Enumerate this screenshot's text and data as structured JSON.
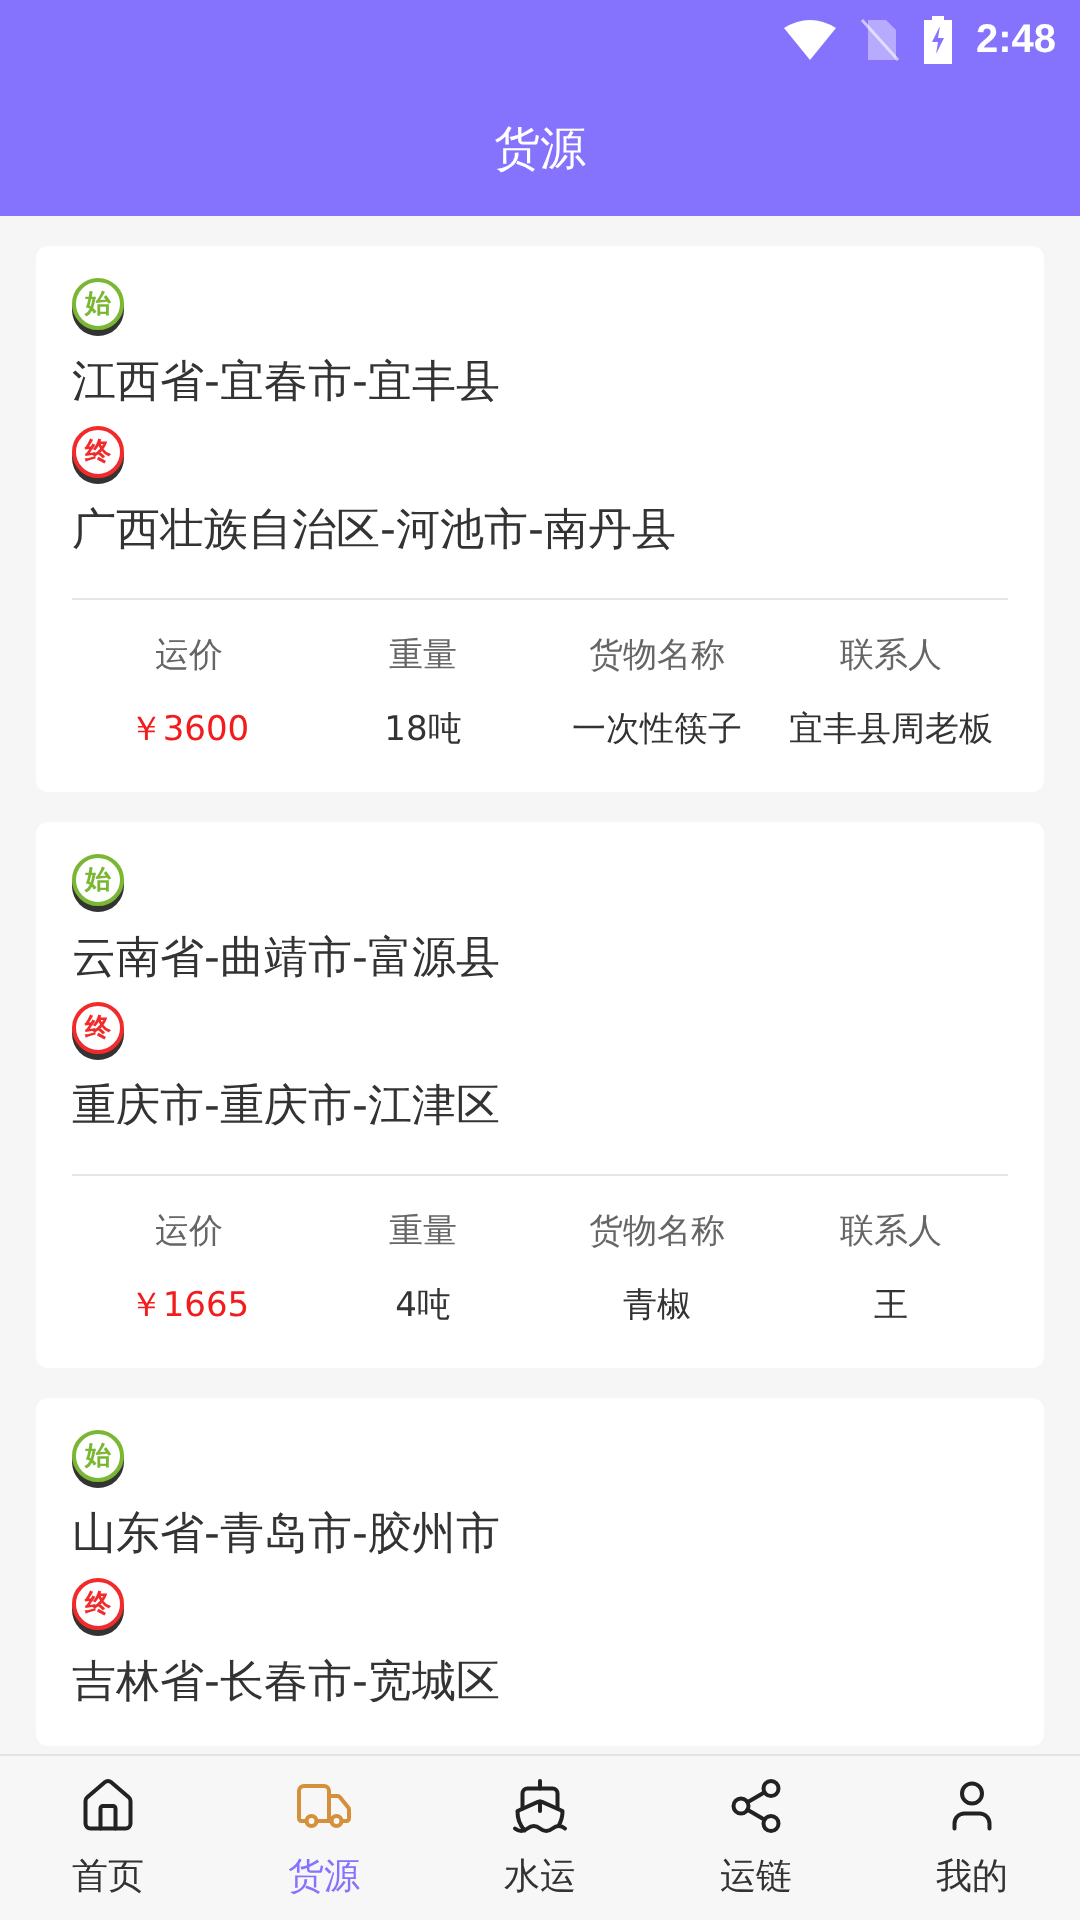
{
  "status_bar": {
    "time": "2:48"
  },
  "header": {
    "title": "货源"
  },
  "cards": [
    {
      "start_badge": "始",
      "start": "江西省-宜春市-宜丰县",
      "end_badge": "终",
      "end": "广西壮族自治区-河池市-南丹县",
      "fields": [
        {
          "label": "运价",
          "value": "￥3600",
          "kind": "price"
        },
        {
          "label": "重量",
          "value": "18吨",
          "kind": "plain"
        },
        {
          "label": "货物名称",
          "value": "一次性筷子",
          "kind": "plain"
        },
        {
          "label": "联系人",
          "value": "宜丰县周老板",
          "kind": "plain"
        }
      ]
    },
    {
      "start_badge": "始",
      "start": "云南省-曲靖市-富源县",
      "end_badge": "终",
      "end": "重庆市-重庆市-江津区",
      "fields": [
        {
          "label": "运价",
          "value": "￥1665",
          "kind": "price"
        },
        {
          "label": "重量",
          "value": "4吨",
          "kind": "plain"
        },
        {
          "label": "货物名称",
          "value": "青椒",
          "kind": "plain"
        },
        {
          "label": "联系人",
          "value": "王",
          "kind": "plain"
        }
      ]
    },
    {
      "start_badge": "始",
      "start": "山东省-青岛市-胶州市",
      "end_badge": "终",
      "end": "吉林省-长春市-宽城区"
    }
  ],
  "nav": [
    {
      "label": "首页",
      "kind": "home",
      "selected": false
    },
    {
      "label": "货源",
      "kind": "truck",
      "selected": true
    },
    {
      "label": "水运",
      "kind": "ship",
      "selected": false
    },
    {
      "label": "运链",
      "kind": "share",
      "selected": false
    },
    {
      "label": "我的",
      "kind": "user",
      "selected": false
    }
  ]
}
